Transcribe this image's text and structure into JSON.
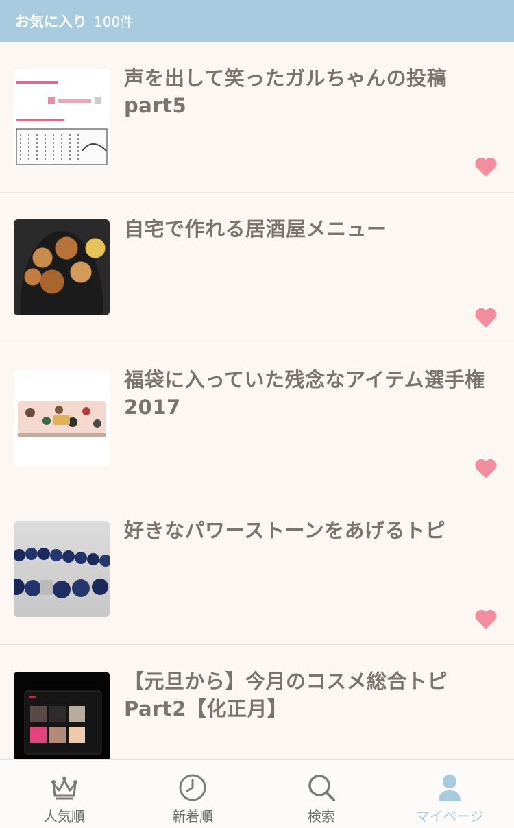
{
  "header": {
    "title": "お気に入り",
    "count": "100件"
  },
  "items": [
    {
      "title": "声を出して笑ったガルちゃんの投稿part5"
    },
    {
      "title": "自宅で作れる居酒屋メニュー"
    },
    {
      "title": "福袋に入っていた残念なアイテム選手権　2017"
    },
    {
      "title": "好きなパワーストーンをあげるトピ"
    },
    {
      "title": "【元旦から】今月のコスメ総合トピPart2【化正月】"
    }
  ],
  "tabs": [
    {
      "label": "人気順",
      "icon": "crown-icon"
    },
    {
      "label": "新着順",
      "icon": "clock-icon"
    },
    {
      "label": "検索",
      "icon": "search-icon"
    },
    {
      "label": "マイページ",
      "icon": "person-icon"
    }
  ],
  "colors": {
    "header_bg": "#a9cbe0",
    "heart": "#f28e9d",
    "title_text": "#7a7372",
    "active_tab": "#a9cbe0"
  }
}
